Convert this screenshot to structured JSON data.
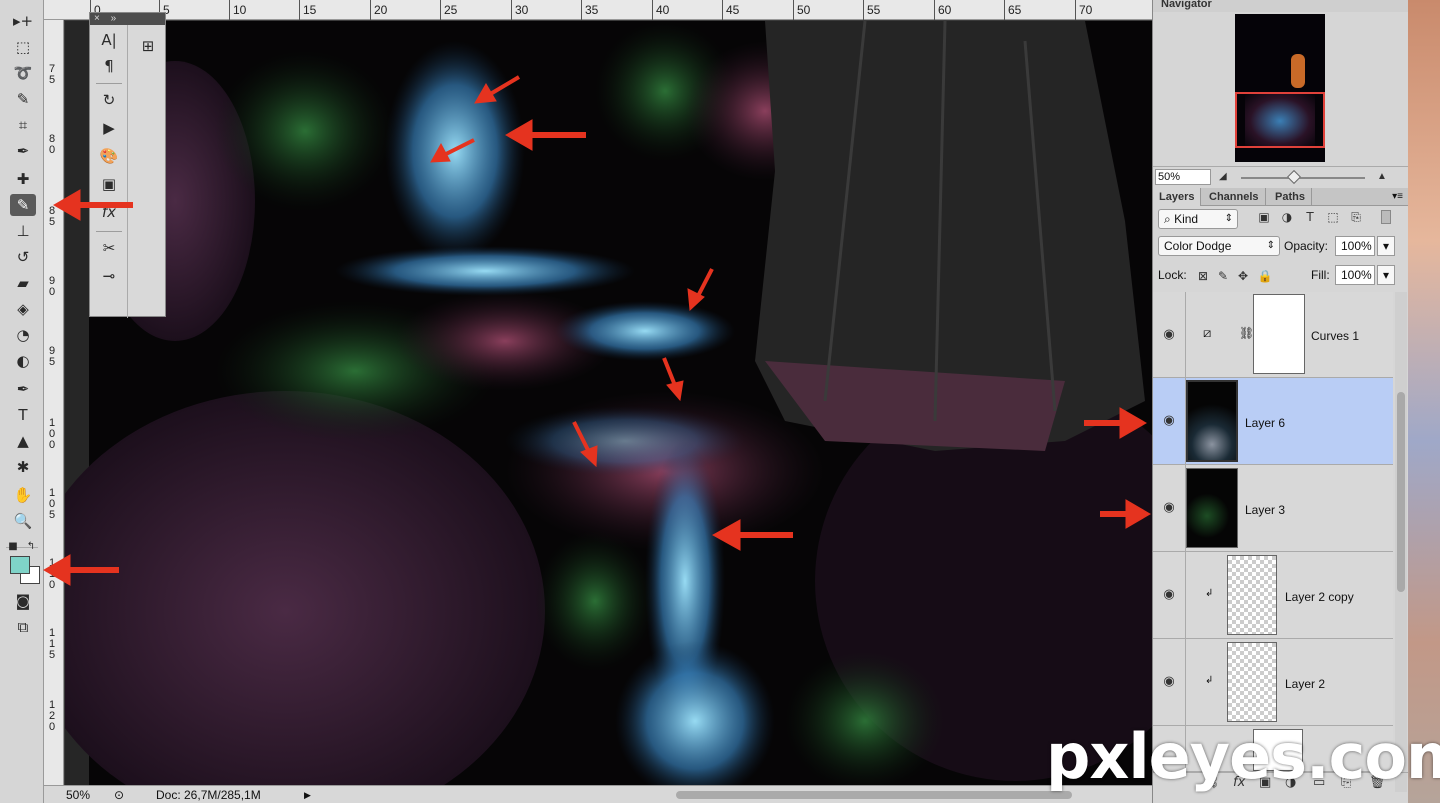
{
  "tools": [
    {
      "name": "move-tool",
      "icon": "▸+"
    },
    {
      "name": "marquee-tool",
      "icon": "⬚"
    },
    {
      "name": "lasso-tool",
      "icon": "➰"
    },
    {
      "name": "quick-select-tool",
      "icon": "✎"
    },
    {
      "name": "crop-tool",
      "icon": "⌗"
    },
    {
      "name": "eyedropper-tool",
      "icon": "✒"
    },
    {
      "name": "healing-brush-tool",
      "icon": "✚"
    },
    {
      "name": "brush-tool",
      "icon": "✎"
    },
    {
      "name": "clone-stamp-tool",
      "icon": "⊥"
    },
    {
      "name": "history-brush-tool",
      "icon": "↺"
    },
    {
      "name": "eraser-tool",
      "icon": "▰"
    },
    {
      "name": "paint-bucket-tool",
      "icon": "◈"
    },
    {
      "name": "blur-tool",
      "icon": "◔"
    },
    {
      "name": "dodge-tool",
      "icon": "◐"
    },
    {
      "name": "pen-tool",
      "icon": "✒"
    },
    {
      "name": "type-tool",
      "icon": "T"
    },
    {
      "name": "path-selection-tool",
      "icon": "▲"
    },
    {
      "name": "custom-shape-tool",
      "icon": "✱"
    },
    {
      "name": "hand-tool",
      "icon": "✋"
    },
    {
      "name": "zoom-tool",
      "icon": "🔍"
    }
  ],
  "ruler_top": [
    "0",
    "5",
    "10",
    "15",
    "20",
    "25",
    "30",
    "35",
    "40",
    "45",
    "50",
    "55",
    "60",
    "65",
    "70"
  ],
  "ruler_left": [
    "7 5",
    "8 0",
    "8 5",
    "9 0",
    "9 5",
    "1 0 0",
    "1 0 5",
    "1 1 0",
    "1 1 5",
    "1 2 0"
  ],
  "float_panel": [
    "A|",
    "¶",
    "↻",
    "▶",
    "🎨",
    "▣",
    "fx",
    "✂",
    "⊸"
  ],
  "status": {
    "zoom": "50%",
    "doc": "Doc: 26,7M/285,1M"
  },
  "navigator": {
    "title": "Navigator",
    "zoom": "50%"
  },
  "panel_tabs": [
    "Layers",
    "Channels",
    "Paths"
  ],
  "filter": {
    "kind": "Kind"
  },
  "blend": {
    "mode": "Color Dodge",
    "opacity_label": "Opacity:",
    "opacity": "100%"
  },
  "lock": {
    "label": "Lock:",
    "fill_label": "Fill:",
    "fill": "100%"
  },
  "layers": [
    {
      "name": "Curves 1",
      "selected": false
    },
    {
      "name": "Layer 6",
      "selected": true
    },
    {
      "name": "Layer 3",
      "selected": false
    },
    {
      "name": "Layer 2 copy",
      "selected": false
    },
    {
      "name": "Layer 2",
      "selected": false
    }
  ],
  "colors": {
    "foreground": "#7fd3c8",
    "background": "#ffffff",
    "arrow": "#e5331f",
    "selected_layer": "#b9cdf5"
  },
  "watermark": "pxleyes.com"
}
